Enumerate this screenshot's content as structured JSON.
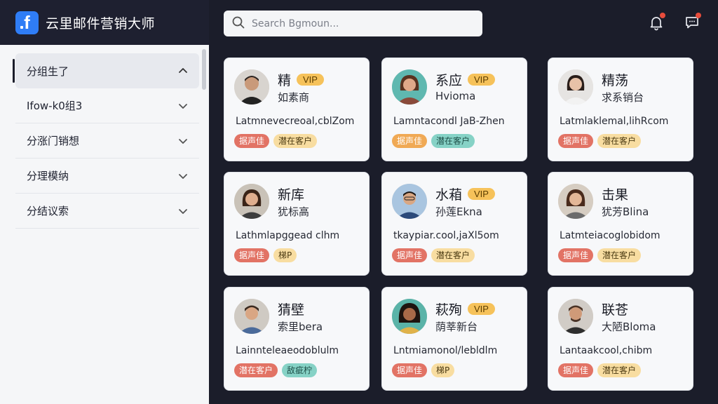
{
  "app": {
    "title": "云里邮件营销大师",
    "logo_glyph": "f"
  },
  "search": {
    "placeholder": "Search Bgmoun..."
  },
  "sidebar": {
    "items": [
      {
        "label": "分组生了",
        "expanded": true
      },
      {
        "label": "Ifow-k0组3",
        "expanded": false
      },
      {
        "label": "分涨门销想",
        "expanded": false
      },
      {
        "label": "分理模纳",
        "expanded": false
      },
      {
        "label": "分结议索",
        "expanded": false
      }
    ]
  },
  "contacts": [
    {
      "name": "精",
      "vip": "VIP",
      "sub": "如素商",
      "email": "Latmnevecreoal,cblZom",
      "tags": [
        {
          "label": "据声佳",
          "color": "red"
        },
        {
          "label": "潜在客户",
          "color": "yellow"
        }
      ]
    },
    {
      "name": "系应",
      "vip": "VIP",
      "sub": "Hvioma",
      "email": "Lamntacondl JaB-Zhen",
      "tags": [
        {
          "label": "据声佳",
          "color": "orange"
        },
        {
          "label": "潜在客户",
          "color": "teal"
        }
      ]
    },
    {
      "name": "精荡",
      "vip": "",
      "sub": "求系销台",
      "email": "Latmlaklemal,lihRcom",
      "tags": [
        {
          "label": "据声佳",
          "color": "red"
        },
        {
          "label": "潜在客户",
          "color": "yellow"
        }
      ]
    },
    {
      "name": "新库",
      "vip": "",
      "sub": "犹标高",
      "email": "Lathmlapggead clhm",
      "tags": [
        {
          "label": "据声佳",
          "color": "red"
        },
        {
          "label": "梯P",
          "color": "yellow"
        }
      ]
    },
    {
      "name": "水葙",
      "vip": "VIP",
      "sub": "孙莲Ekna",
      "email": "tkaypiar.cool,jaXl5om",
      "tags": [
        {
          "label": "据声佳",
          "color": "red"
        },
        {
          "label": "潜在客户",
          "color": "yellow"
        }
      ]
    },
    {
      "name": "击果",
      "vip": "",
      "sub": "犹芳Blina",
      "email": "Latmteiacoglobidom",
      "tags": [
        {
          "label": "据声佳",
          "color": "red"
        },
        {
          "label": "潜在客户",
          "color": "yellow"
        }
      ]
    },
    {
      "name": "猜壁",
      "vip": "",
      "sub": "索里bera",
      "email": "Lainnteleaeodoblulm",
      "tags": [
        {
          "label": "潜在客户",
          "color": "red"
        },
        {
          "label": "敌疵柠",
          "color": "teal"
        }
      ]
    },
    {
      "name": "萩殉",
      "vip": "VIP",
      "sub": "荫莘新台",
      "email": "Lntmiamonol/lebldlm",
      "tags": [
        {
          "label": "据声佳",
          "color": "red"
        },
        {
          "label": "梯P",
          "color": "yellow"
        }
      ]
    },
    {
      "name": "联苍",
      "vip": "",
      "sub": "大陋Bloma",
      "email": "Lantaakcool,chibm",
      "tags": [
        {
          "label": "据声佳",
          "color": "red"
        },
        {
          "label": "潜在客户",
          "color": "yellow"
        }
      ]
    }
  ],
  "colors": {
    "accent": "#2f7df6",
    "dark_bg": "#1b1d2a",
    "vip": "#f6c25a",
    "notification_dot": "#e74c3c"
  },
  "icons": {
    "search": "search-icon",
    "bell": "bell-icon",
    "message": "message-icon",
    "chevron": "chevron-icon"
  }
}
